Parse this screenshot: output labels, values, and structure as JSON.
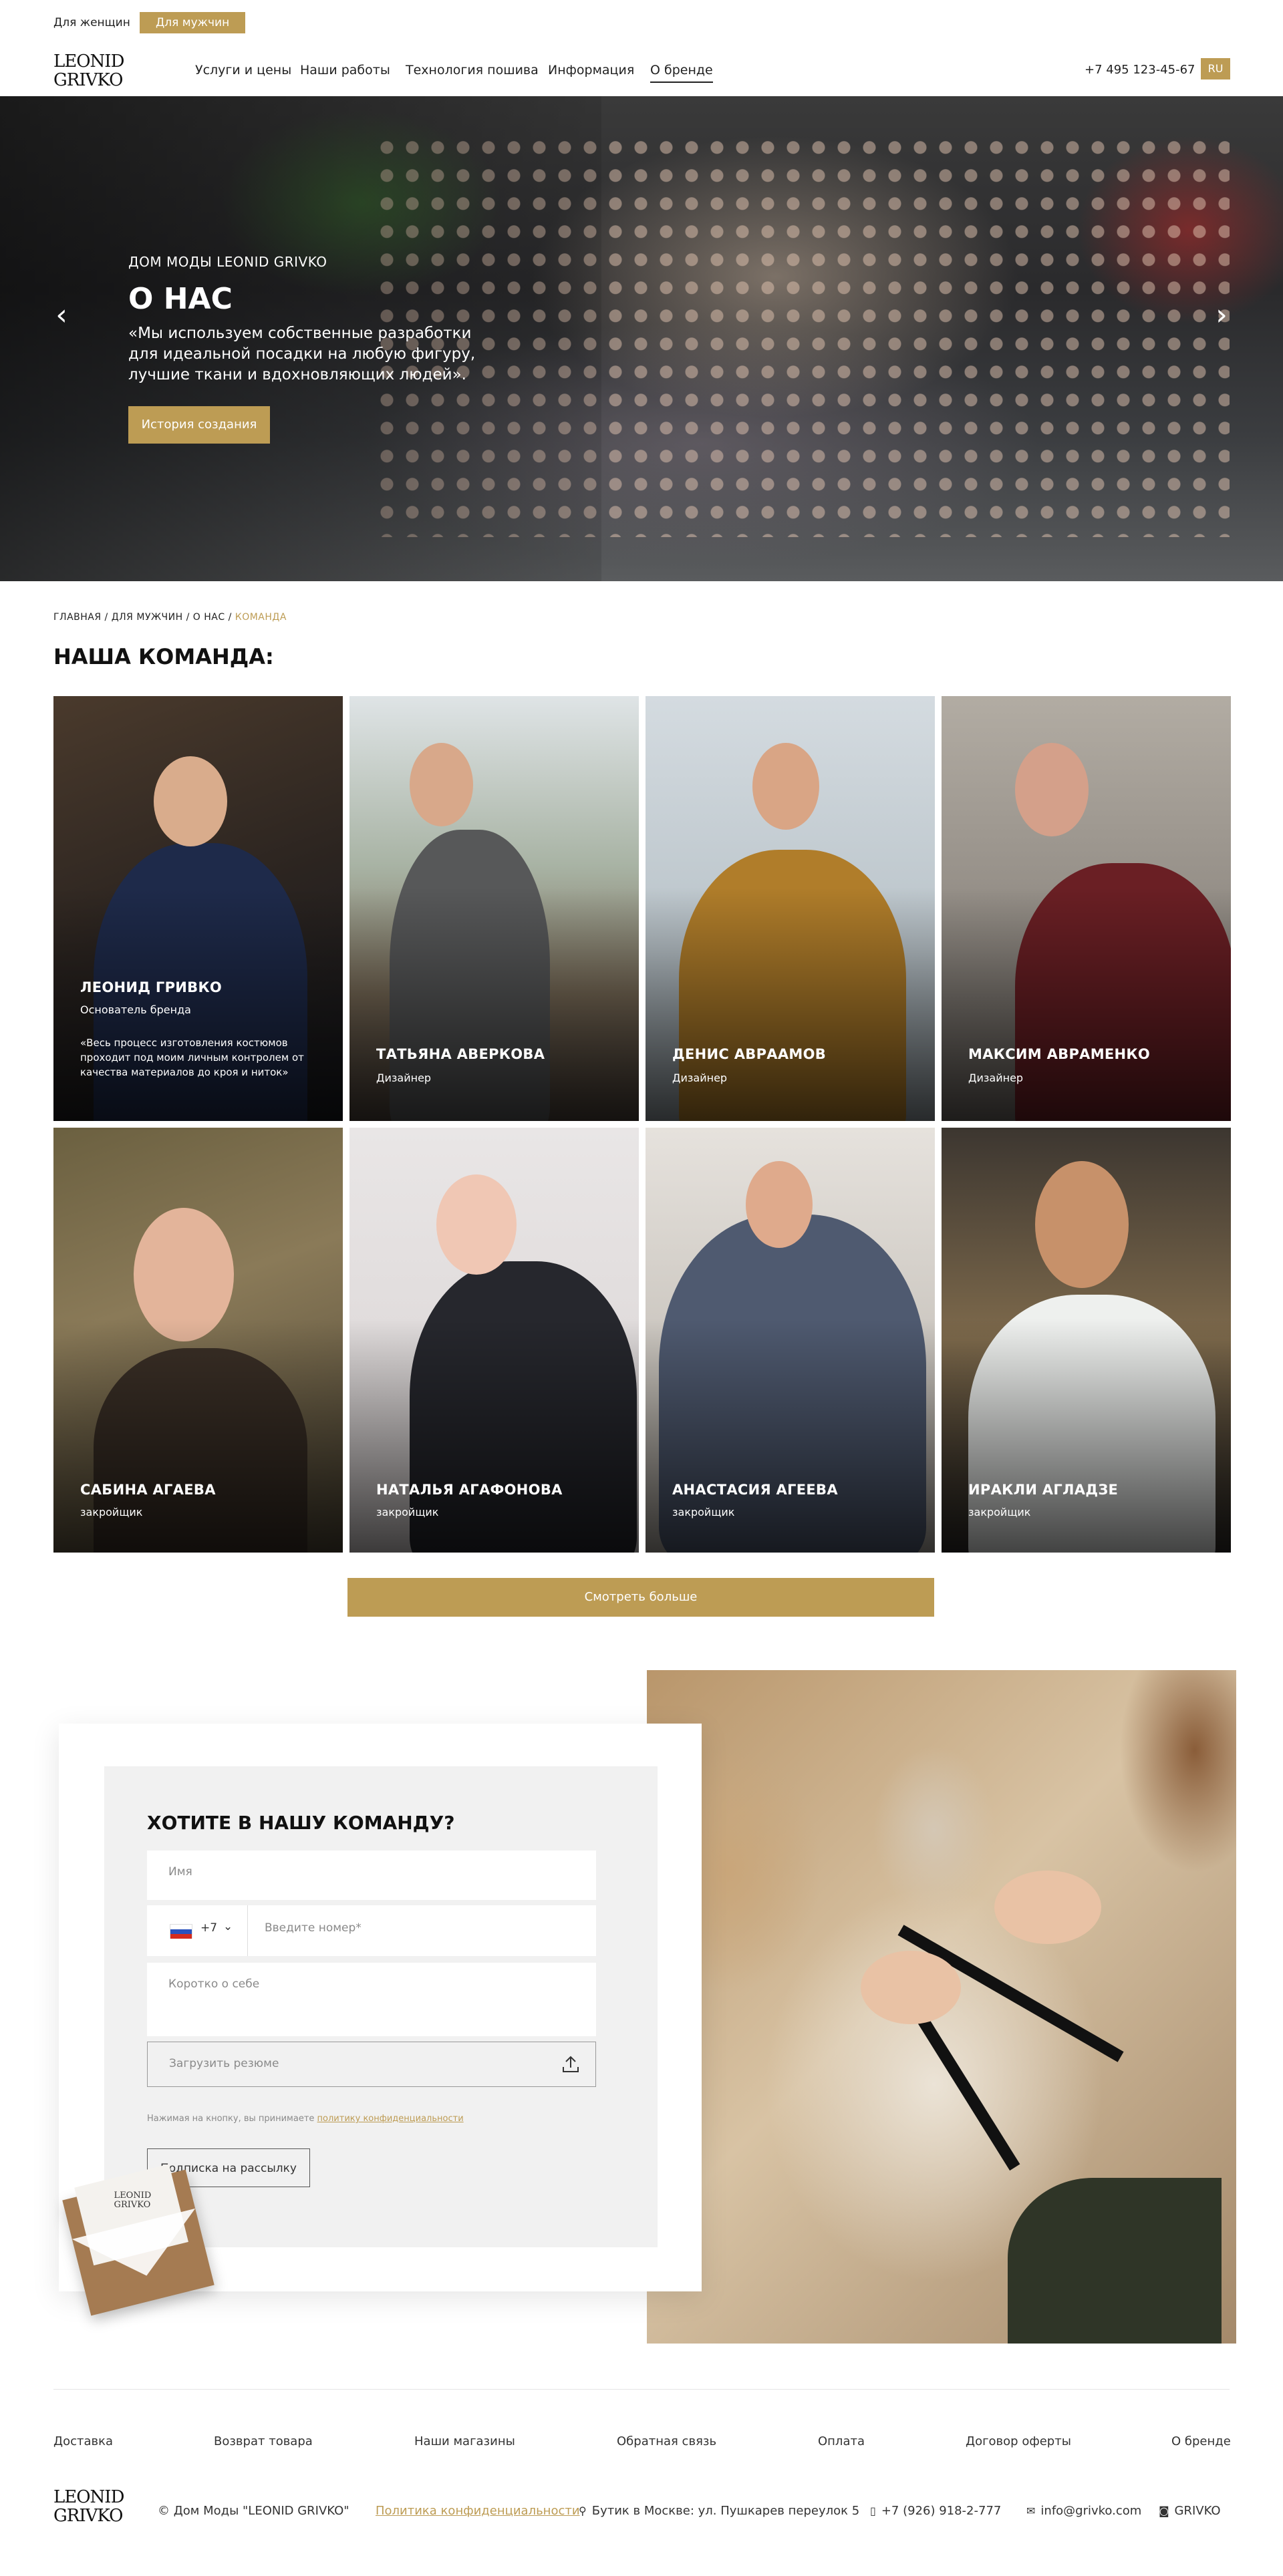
{
  "topbar": {
    "women": "Для женщин",
    "men": "Для мужчин"
  },
  "header": {
    "logo_line1": "LEONID",
    "logo_line2": "GRIVKO",
    "nav": [
      "Услуги и цены",
      "Наши работы",
      "Технология пошива",
      "Информация",
      "О бренде"
    ],
    "phone": "+7 495 123-45-67",
    "lang": "RU"
  },
  "hero": {
    "subtitle": "ДОМ МОДЫ LEONID GRIVKO",
    "title": "О НАС",
    "text": "«Мы используем собственные разработки для идеальной посадки на любую фигуру, лучшие ткани и вдохновляющих людей».",
    "button": "История создания"
  },
  "breadcrumb": {
    "items": [
      "ГЛАВНАЯ",
      "ДЛЯ МУЖЧИН",
      "О НАС"
    ],
    "current": "КОМАНДА",
    "sep": " / "
  },
  "team": {
    "title": "НАША КОМАНДА:",
    "members": [
      {
        "name": "ЛЕОНИД ГРИВКО",
        "role": "Основатель бренда",
        "quote": "«Весь процесс изготовления костюмов проходит под моим личным контролем от качества материалов до кроя и ниток»"
      },
      {
        "name": "ТАТЬЯНА АВЕРКОВА",
        "role": "Дизайнер"
      },
      {
        "name": "ДЕНИС АВРААМОВ",
        "role": "Дизайнер"
      },
      {
        "name": "МАКСИМ АВРАМЕНКО",
        "role": "Дизайнер"
      },
      {
        "name": "САБИНА АГАЕВА",
        "role": "закройщик"
      },
      {
        "name": "НАТАЛЬЯ АГАФОНОВА",
        "role": "закройщик"
      },
      {
        "name": "АНАСТАСИЯ АГЕЕВА",
        "role": "закройщик"
      },
      {
        "name": "ИРАКЛИ АГЛАДЗЕ",
        "role": "закройщик"
      }
    ],
    "more_button": "Смотреть больше"
  },
  "join": {
    "title": "ХОТИТЕ В НАШУ КОМАНДУ?",
    "name_placeholder": "Имя",
    "phone_code": "+7",
    "phone_placeholder": "Введите номер*",
    "about_placeholder": "Коротко о себе",
    "upload_label": "Загрузить резюме",
    "consent_text": "Нажимая на кнопку, вы принимаете",
    "consent_link": "политику конфиденциальности",
    "submit": "Подписка на рассылку",
    "envelope_logo_1": "LEONID",
    "envelope_logo_2": "GRIVKO"
  },
  "footer": {
    "nav": [
      "Доставка",
      "Возврат товара",
      "Наши магазины",
      "Обратная связь",
      "Оплата",
      "Договор оферты",
      "О бренде"
    ],
    "copyright": "© Дом Моды \"LEONID GRIVKO\"",
    "privacy": "Политика конфиденциальности",
    "address": "Бутик в Москве: ул. Пушкарев переулок 5",
    "phone": "+7 (926) 918-2-777",
    "email": "info@grivko.com",
    "instagram": "GRIVKO"
  },
  "colors": {
    "accent": "#bd9c54",
    "text": "#1d1d1d",
    "muted": "#8a8a8a"
  }
}
